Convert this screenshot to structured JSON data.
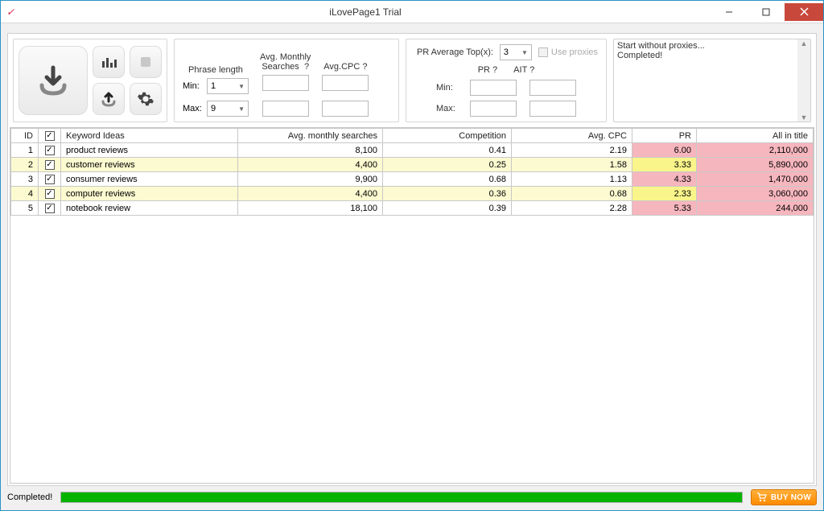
{
  "window": {
    "title": "iLovePage1 Trial"
  },
  "filters": {
    "phrase_length_label": "Phrase length",
    "min_label": "Min:",
    "max_label": "Max:",
    "phrase_min": "1",
    "phrase_max": "9",
    "avg_monthly_label": "Avg. Monthly\nSearches",
    "avg_cpc_label": "Avg.CPC",
    "qmark": "?",
    "pr_avg_top_label": "PR Average Top(x):",
    "pr_avg_top_val": "3",
    "use_proxies_label": "Use proxies",
    "pr_label": "PR",
    "ait_label": "AIT"
  },
  "log": {
    "line1": "Start without proxies...",
    "line2": "Completed!"
  },
  "table": {
    "headers": {
      "id": "ID",
      "keyword": "Keyword Ideas",
      "ams": "Avg. monthly searches",
      "comp": "Competition",
      "cpc": "Avg. CPC",
      "pr": "PR",
      "ait": "All in title"
    },
    "rows": [
      {
        "id": "1",
        "kw": "product reviews",
        "ams": "8,100",
        "comp": "0.41",
        "cpc": "2.19",
        "pr": "6.00",
        "pr_cls": "pr-p",
        "ait": "2,110,000",
        "row_cls": ""
      },
      {
        "id": "2",
        "kw": "customer reviews",
        "ams": "4,400",
        "comp": "0.25",
        "cpc": "1.58",
        "pr": "3.33",
        "pr_cls": "pr-y",
        "ait": "5,890,000",
        "row_cls": "row-y"
      },
      {
        "id": "3",
        "kw": "consumer reviews",
        "ams": "9,900",
        "comp": "0.68",
        "cpc": "1.13",
        "pr": "4.33",
        "pr_cls": "pr-p",
        "ait": "1,470,000",
        "row_cls": ""
      },
      {
        "id": "4",
        "kw": "computer reviews",
        "ams": "4,400",
        "comp": "0.36",
        "cpc": "0.68",
        "pr": "2.33",
        "pr_cls": "pr-y",
        "ait": "3,060,000",
        "row_cls": "row-y"
      },
      {
        "id": "5",
        "kw": "notebook review",
        "ams": "18,100",
        "comp": "0.39",
        "cpc": "2.28",
        "pr": "5.33",
        "pr_cls": "pr-p",
        "ait": "244,000",
        "row_cls": ""
      }
    ]
  },
  "status": {
    "text": "Completed!",
    "progress_pct": 100,
    "buy_label": "BUY NOW"
  }
}
